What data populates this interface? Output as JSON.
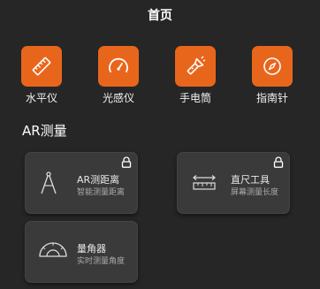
{
  "header": {
    "title": "首页"
  },
  "tools": [
    {
      "label": "水平仪",
      "icon": "ruler-level-icon"
    },
    {
      "label": "光感仪",
      "icon": "gauge-icon"
    },
    {
      "label": "手电筒",
      "icon": "flashlight-icon"
    },
    {
      "label": "指南针",
      "icon": "compass-icon"
    }
  ],
  "section": {
    "title": "AR测量"
  },
  "cards": [
    {
      "title": "AR测距离",
      "subtitle": "智能测量距离",
      "icon": "compass-drafting-icon",
      "locked": true
    },
    {
      "title": "直尺工具",
      "subtitle": "屏幕测量长度",
      "icon": "ruler-arrow-icon",
      "locked": true
    },
    {
      "title": "量角器",
      "subtitle": "实时测量角度",
      "icon": "protractor-icon",
      "locked": false
    }
  ],
  "colors": {
    "accent": "#e8661c",
    "background": "#262626",
    "card": "#3a3a3a"
  }
}
